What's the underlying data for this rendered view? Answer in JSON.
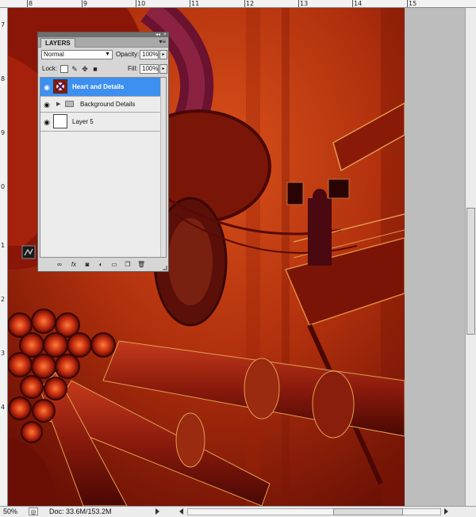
{
  "rulers": {
    "top_labels": [
      "8",
      "9",
      "10",
      "11",
      "12",
      "13",
      "14",
      "15"
    ],
    "left_labels": [
      "7",
      "8",
      "9",
      "0",
      "1",
      "2",
      "3",
      "4"
    ]
  },
  "layers_panel": {
    "tab_label": "LAYERS",
    "blend_mode": "Normal",
    "opacity_label": "Opacity:",
    "opacity_value": "100%",
    "lock_label": "Lock:",
    "fill_label": "Fill:",
    "fill_value": "100%",
    "layers": [
      {
        "name": "Heart and Details",
        "selected": true
      },
      {
        "name": "Background Details",
        "selected": false
      },
      {
        "name": "Layer 5",
        "selected": false
      }
    ]
  },
  "status_bar": {
    "zoom": "50%",
    "doc_size": "Doc: 33.6M/153.2M"
  },
  "colors": {
    "selection": "#3d8ff0",
    "canvas_dark": "#6a0f05",
    "canvas_mid": "#b32a0c",
    "canvas_glow": "#e0561a"
  }
}
